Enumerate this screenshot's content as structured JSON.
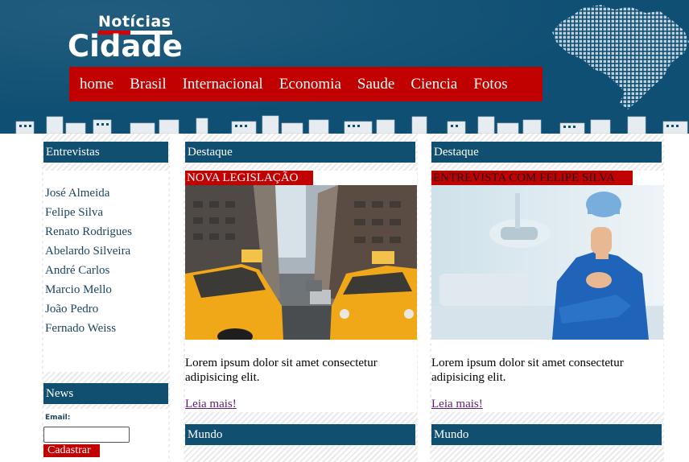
{
  "brand": {
    "logo_top": "Notícias",
    "logo_main": "Cidade"
  },
  "nav": [
    "home",
    "Brasil",
    "Internacional",
    "Economia",
    "Saude",
    "Ciencia",
    "Fotos"
  ],
  "sidebar": {
    "interviews_title": "Entrevistas",
    "interviews": [
      "José Almeida",
      "Felipe Silva",
      "Renato Rodrigues",
      "Abelardo Silveira",
      "André Carlos",
      "Marcio Mello",
      "João Pedro",
      "Fernado Weiss"
    ],
    "news_title": "News",
    "email_label": "Email:",
    "email_value": "",
    "signup_label": "Cadastrar"
  },
  "highlights": [
    {
      "section": "Destaque",
      "tag": "NOVA LEGISLAÇÃO",
      "image": "taxis-street-photo",
      "text": "Lorem ipsum dolor sit amet consectetur adipisicing elit.",
      "more": "Leia mais!",
      "next_section": "Mundo"
    },
    {
      "section": "Destaque",
      "tag": "ENTREVISTA COM FELIPE SILVA",
      "image": "doctor-photo",
      "text": "Lorem ipsum dolor sit amet consectetur adipisicing elit.",
      "more": "Leia mais!",
      "next_section": "Mundo"
    }
  ],
  "colors": {
    "header_bg": "#0f4f73",
    "nav_bg": "#c10000",
    "box_head": "#114f70",
    "link_visited": "#5e1c77"
  }
}
